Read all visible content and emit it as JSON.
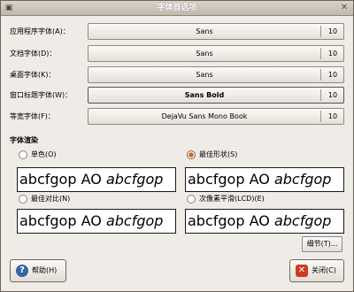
{
  "window": {
    "title": "字体首选项"
  },
  "fonts": [
    {
      "label": "应用程序字体(A)：",
      "font": "Sans",
      "size": "10"
    },
    {
      "label": "文档字体(D)：",
      "font": "Sans",
      "size": "10"
    },
    {
      "label": "桌面字体(K)：",
      "font": "Sans",
      "size": "10"
    },
    {
      "label": "窗口标题字体(W)：",
      "font": "Sans Bold",
      "size": "10"
    },
    {
      "label": "等宽字体(F)：",
      "font": "DejaVu Sans Mono Book",
      "size": "10"
    }
  ],
  "rendering": {
    "title": "字体渲染",
    "options": [
      {
        "label": "单色(O)",
        "checked": false,
        "preview": "abcfgop AO",
        "preview_italic": "abcfgop"
      },
      {
        "label": "最佳形状(S)",
        "checked": true,
        "preview": "abcfgop AO",
        "preview_italic": "abcfgop"
      },
      {
        "label": "最佳对比(N)",
        "checked": false,
        "preview": "abcfgop AO",
        "preview_italic": "abcfgop"
      },
      {
        "label": "次像素平滑(LCD)(E)",
        "checked": false,
        "preview": "abcfgop AO",
        "preview_italic": "abcfgop"
      }
    ]
  },
  "buttons": {
    "details": "细节(T)...",
    "help": "帮助(H)",
    "close": "关闭(C)"
  },
  "colors": {
    "window_bg": "#efebe7",
    "titlebar": "#c1b9ac",
    "radio_selected": "#d4602a"
  }
}
